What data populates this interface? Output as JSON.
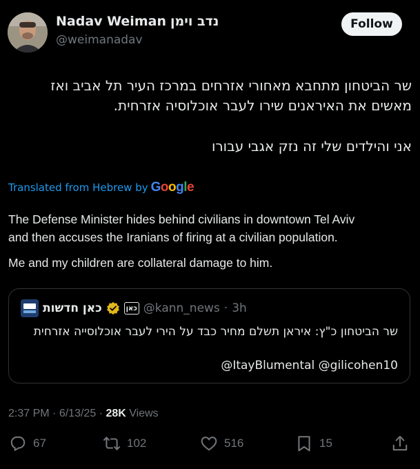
{
  "author": {
    "name": "Nadav Weiman",
    "name_hebrew": "נדב וימן",
    "handle": "@weimanadav"
  },
  "follow_label": "Follow",
  "post": {
    "hebrew_lines": [
      "שר הביטחון מתחבא מאחורי אזרחים במרכז העיר תל אביב ואז",
      "מאשים את האיראנים שירו לעבר אוכלוסיה אזרחית.",
      "אני והילדים שלי זה נזק אגבי עבורו"
    ],
    "translated_label": "Translated from Hebrew by",
    "translation_provider": "Google",
    "english_lines": [
      "The Defense Minister hides behind civilians in downtown Tel Aviv",
      "and then accuses the Iranians of firing at a civilian population.",
      "Me and my children are collateral damage to him."
    ]
  },
  "quote": {
    "avatar_text": "כאן",
    "name": "כאן חדשות",
    "badge": "כאן",
    "handle": "@kann_news",
    "separator": "·",
    "time": "3h",
    "text": "שר הביטחון כ\"ץ: איראן תשלם מחיר כבד על הירי לעבר אוכלוסייה אזרחית",
    "mentions": "@ItayBlumental @gilicohen10"
  },
  "meta": {
    "time": "2:37 PM",
    "separator": "·",
    "date": "6/13/25",
    "separator2": "·",
    "views_count": "28K",
    "views_label": "Views"
  },
  "actions": {
    "replies": "67",
    "reposts": "102",
    "likes": "516",
    "bookmarks": "15"
  },
  "colors": {
    "background": "#000000",
    "text": "#e7e9ea",
    "secondary": "#71767b",
    "link": "#1d9bf0",
    "verified_gold": "#e2b719",
    "border": "#2f3336"
  },
  "icons": [
    "reply-icon",
    "repost-icon",
    "like-icon",
    "bookmark-icon",
    "share-icon",
    "verified-badge-icon"
  ]
}
